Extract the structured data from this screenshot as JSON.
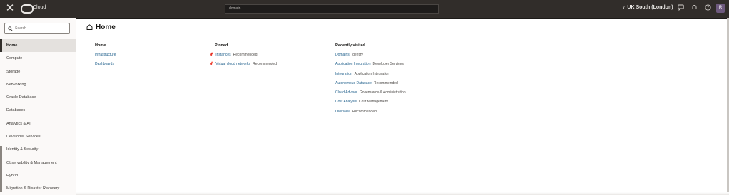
{
  "topbar": {
    "brand": "Cloud",
    "search_value": "domain",
    "region": "UK South (London)",
    "avatar_initial": "R",
    "icons": [
      "close-icon",
      "cloud-logo-icon",
      "chevron-down-icon",
      "chat-icon",
      "bell-icon",
      "help-icon",
      "avatar"
    ]
  },
  "sidebar": {
    "search_placeholder": "Search",
    "items": [
      {
        "label": "Home"
      },
      {
        "label": "Compute"
      },
      {
        "label": "Storage"
      },
      {
        "label": "Networking"
      },
      {
        "label": "Oracle Database"
      },
      {
        "label": "Databases"
      },
      {
        "label": "Analytics & AI"
      },
      {
        "label": "Developer Services"
      },
      {
        "label": "Identity & Security"
      },
      {
        "label": "Observability & Management"
      },
      {
        "label": "Hybrid"
      },
      {
        "label": "Migration & Disaster Recovery"
      }
    ]
  },
  "main": {
    "title": "Home",
    "home": {
      "heading": "Home",
      "links": [
        {
          "label": "Infrastructure"
        },
        {
          "label": "Dashboards"
        }
      ]
    },
    "pinned": {
      "heading": "Pinned",
      "items": [
        {
          "label": "Instances",
          "tag": "Recommended"
        },
        {
          "label": "Virtual cloud networks",
          "tag": "Recommended"
        }
      ]
    },
    "recent": {
      "heading": "Recently visited",
      "items": [
        {
          "label": "Domains",
          "tag": "Identity"
        },
        {
          "label": "Application Integration",
          "tag": "Developer Services"
        },
        {
          "label": "Integration",
          "tag": "Application Integration"
        },
        {
          "label": "Autonomous Database",
          "tag": "Recommended"
        },
        {
          "label": "Cloud Advisor",
          "tag": "Governance & Administration"
        },
        {
          "label": "Cost Analysis",
          "tag": "Cost Management"
        },
        {
          "label": "Overview",
          "tag": "Recommended"
        }
      ]
    }
  },
  "colors": {
    "topbar_bg": "#312d2a",
    "link": "#1f5f8b",
    "sidebar_bg": "#fbf9f8",
    "active_item_bg": "#e4e1de"
  }
}
